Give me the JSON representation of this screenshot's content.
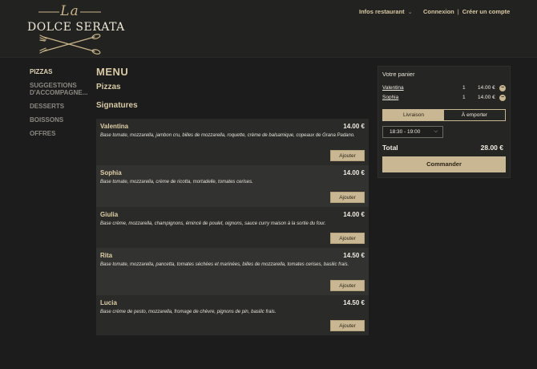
{
  "brand": {
    "script": "La",
    "name": "DOLCE SERATA"
  },
  "topnav": {
    "info": "Infos restaurant",
    "login": "Connexion",
    "separator": "|",
    "register": "Créer un compte"
  },
  "sidebar": {
    "items": [
      {
        "label": "PIZZAS"
      },
      {
        "label": "SUGGESTIONS D'ACCOMPAGNE..."
      },
      {
        "label": "DESSERTS"
      },
      {
        "label": "BOISSONS"
      },
      {
        "label": "OFFRES"
      }
    ]
  },
  "menu": {
    "title": "MENU",
    "category": "Pizzas",
    "subcategory": "Signatures",
    "add_label": "Ajouter",
    "items": [
      {
        "name": "Valentina",
        "price": "14.00 €",
        "desc": "Base tomate, mozzarella, jambon cru, billes de mozzarella, roquette, crème de balsamique, copeaux de Grana Padano."
      },
      {
        "name": "Sophia",
        "price": "14.00 €",
        "desc": "Base tomate, mozzarella, crème de ricotta, mortadelle, tomates cerises."
      },
      {
        "name": "Giulia",
        "price": "14.00 €",
        "desc": "Base crème, mozzarella, champignons, émincé de poulet, oignons, sauce curry maison à la sortie du four."
      },
      {
        "name": "Rita",
        "price": "14.50 €",
        "desc": "Base tomate, mozzarella, pancetta, tomates séchées et marinées, billes de mozzarella, tomates cerises, basilic frais."
      },
      {
        "name": "Lucia",
        "price": "14.50 €",
        "desc": "Base crème de pesto, mozzarella, fromage de chèvre, pignons de pin, basilic frais."
      }
    ]
  },
  "cart": {
    "title": "Votre panier",
    "lines": [
      {
        "name": "Valentina",
        "qty": "1",
        "price": "14.00 €"
      },
      {
        "name": "Sophia",
        "qty": "1",
        "price": "14.00 €"
      }
    ],
    "remove_glyph": "−",
    "modes": {
      "delivery": "Livraison",
      "takeaway": "À emporter",
      "selected": "delivery"
    },
    "timeslot": "18:30 - 19:00",
    "total_label": "Total",
    "total_value": "28.00 €",
    "order_label": "Commander"
  },
  "colors": {
    "accent": "#c9b692",
    "background": "#1c1c1c",
    "card": "#2a2a29",
    "heading": "#d9c9a4"
  }
}
